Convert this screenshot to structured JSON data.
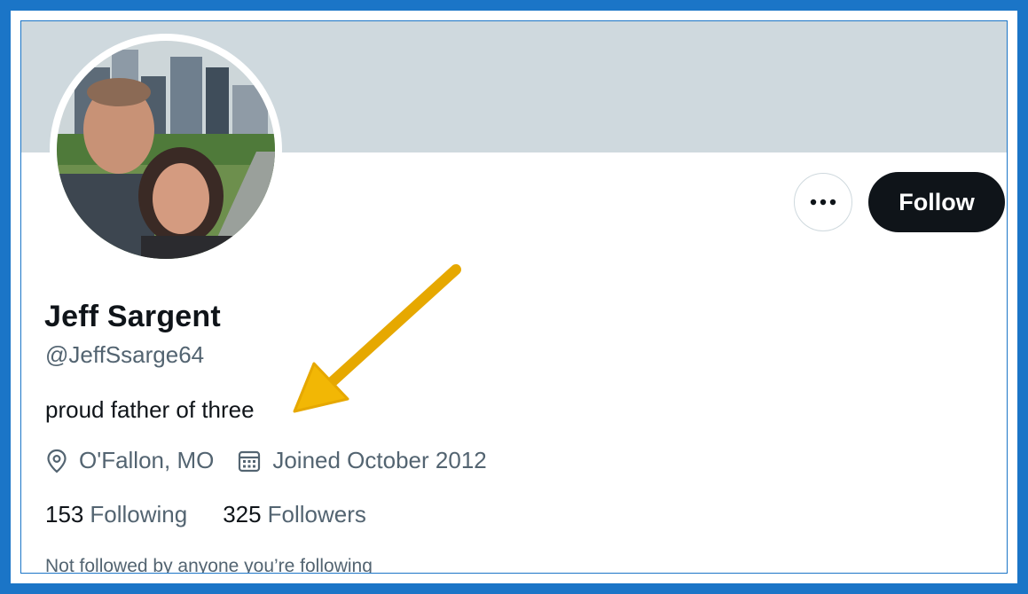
{
  "profile": {
    "display_name": "Jeff Sargent",
    "handle": "@JeffSsarge64",
    "bio": "proud father of three",
    "location": "O'Fallon, MO",
    "joined": "Joined October 2012",
    "following_count": "153",
    "following_label": "Following",
    "followers_count": "325",
    "followers_label": "Followers",
    "social_context": "Not followed by anyone you’re following"
  },
  "actions": {
    "more_label": "•••",
    "follow_label": "Follow"
  },
  "icons": {
    "location": "location-pin-icon",
    "calendar": "calendar-icon",
    "more": "more-options-icon"
  },
  "colors": {
    "banner": "#cfd9de",
    "frame": "#1b75c7",
    "follow_button": "#0f1419",
    "secondary_text": "#536471",
    "annotation_arrow": "#f2b705"
  }
}
